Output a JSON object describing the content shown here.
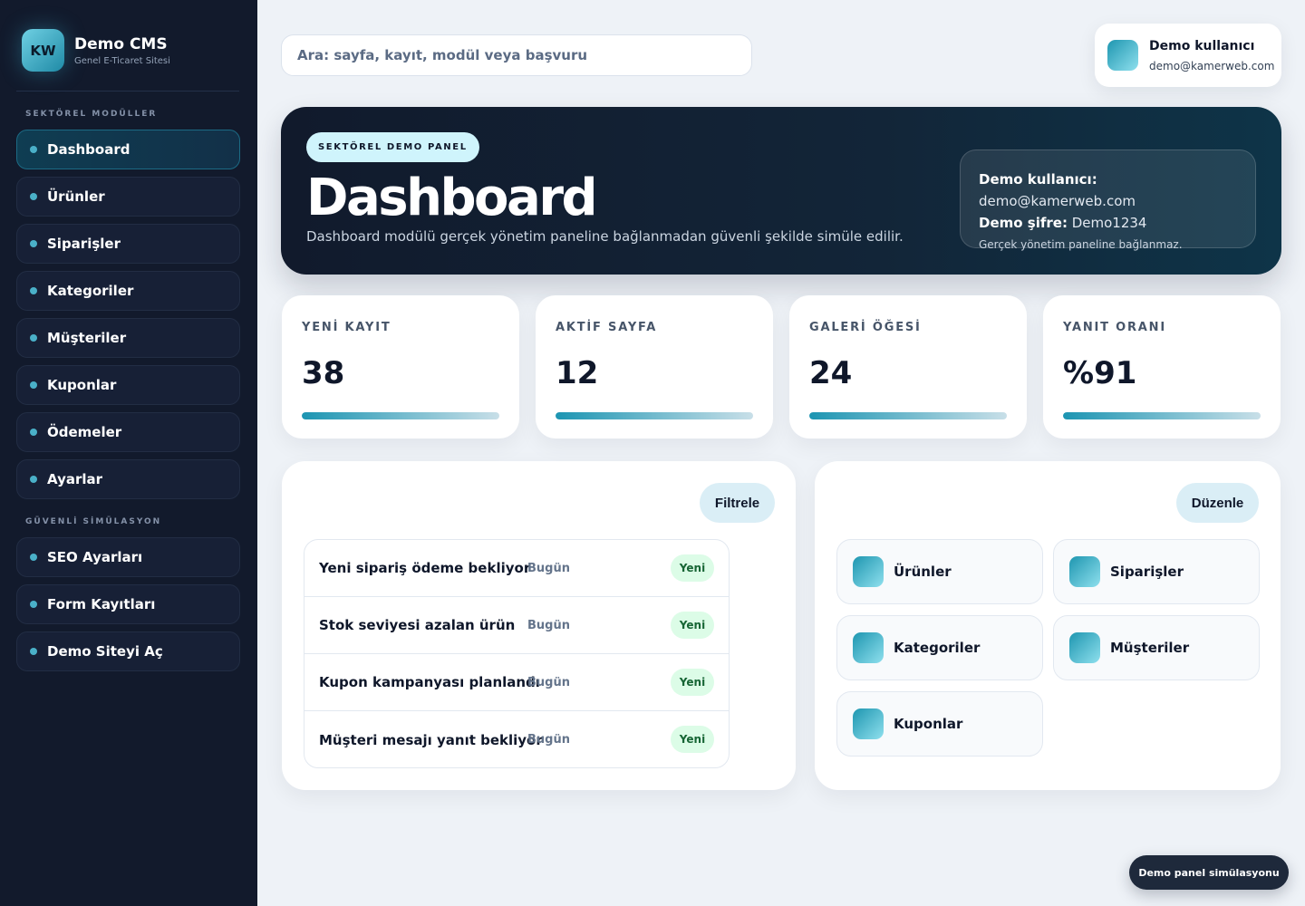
{
  "brand": {
    "logo": "KW",
    "name": "Demo CMS",
    "subtitle": "Genel E-Ticaret Sitesi"
  },
  "sidebar": {
    "section1": "SEKTÖREL MODÜLLER",
    "section2": "GÜVENLİ SİMÜLASYON",
    "items": [
      {
        "label": "Dashboard",
        "active": true
      },
      {
        "label": "Ürünler"
      },
      {
        "label": "Siparişler"
      },
      {
        "label": "Kategoriler"
      },
      {
        "label": "Müşteriler"
      },
      {
        "label": "Kuponlar"
      },
      {
        "label": "Ödemeler"
      },
      {
        "label": "Ayarlar"
      }
    ],
    "sim_items": [
      {
        "label": "SEO Ayarları"
      },
      {
        "label": "Form Kayıtları"
      },
      {
        "label": "Demo Siteyi Aç"
      }
    ]
  },
  "search": {
    "placeholder": "Ara: sayfa, kayıt, modül veya başvuru"
  },
  "user": {
    "name": "Demo kullanıcı",
    "email": "demo@kamerweb.com"
  },
  "hero": {
    "pill": "SEKTÖREL DEMO PANEL",
    "title": "Dashboard",
    "description": "Dashboard modülü gerçek yönetim paneline bağlanmadan güvenli şekilde simüle edilir.",
    "user_label": "Demo kullanıcı:",
    "user_value": "demo@kamerweb.com",
    "password_label": "Demo şifre:",
    "password_value": "Demo1234",
    "note": "Gerçek yönetim paneline bağlanmaz."
  },
  "stats": [
    {
      "label": "YENİ KAYIT",
      "value": "38",
      "progress": 1.0
    },
    {
      "label": "AKTİF SAYFA",
      "value": "12",
      "progress": 1.0
    },
    {
      "label": "GALERİ ÖĞESİ",
      "value": "24",
      "progress": 1.0
    },
    {
      "label": "YANIT ORANI",
      "value": "%91",
      "progress": 1.0
    }
  ],
  "activity_panel": {
    "button": "Filtrele",
    "rows": [
      {
        "title": "Yeni sipariş ödeme bekliyor",
        "date": "Bugün",
        "badge": "Yeni"
      },
      {
        "title": "Stok seviyesi azalan ürün",
        "date": "Bugün",
        "badge": "Yeni"
      },
      {
        "title": "Kupon kampanyası planlandı",
        "date": "Bugün",
        "badge": "Yeni"
      },
      {
        "title": "Müşteri mesajı yanıt bekliyor",
        "date": "Bugün",
        "badge": "Yeni"
      }
    ]
  },
  "modules_panel": {
    "button": "Düzenle",
    "tiles": [
      {
        "label": "Ürünler"
      },
      {
        "label": "Siparişler"
      },
      {
        "label": "Kategoriler"
      },
      {
        "label": "Müşteriler"
      },
      {
        "label": "Kuponlar"
      }
    ]
  },
  "footer_badge": "Demo panel simülasyonu"
}
